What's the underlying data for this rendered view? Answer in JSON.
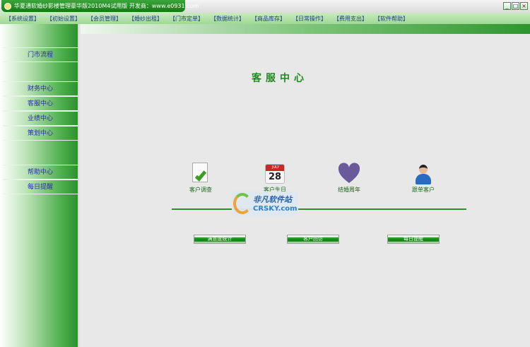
{
  "window": {
    "title": "华夏通软婚纱影楼管理豪华版2010M4试用版   开发商：www.e0931.com",
    "minimize": "_",
    "maximize": "□",
    "close": "×"
  },
  "menu": [
    "【系统设置】",
    "【初始设置】",
    "【会员管理】",
    "【婚纱出租】",
    "【门市定单】",
    "【数据统计】",
    "【商品库存】",
    "【日常操作】",
    "【费用支出】",
    "【软件帮助】"
  ],
  "sidebar": {
    "items": [
      "门市流程",
      "财务中心",
      "客服中心",
      "业绩中心",
      "策划中心",
      "帮助中心",
      "每日提醒"
    ]
  },
  "main": {
    "heading": "客服中心",
    "features": [
      {
        "label": "客户调查",
        "icon": "document-check-icon"
      },
      {
        "label": "客户生日",
        "icon": "calendar-icon",
        "date_month": "JULY",
        "date_day": "28"
      },
      {
        "label": "结婚周年",
        "icon": "heart-icon"
      },
      {
        "label": "跟单客户",
        "icon": "customer-icon"
      }
    ],
    "buttons": [
      "满意度统计",
      "客户回访",
      "每日提醒"
    ]
  },
  "watermark": {
    "line1": "非凡软件站",
    "line2": "CRSKY.com"
  }
}
